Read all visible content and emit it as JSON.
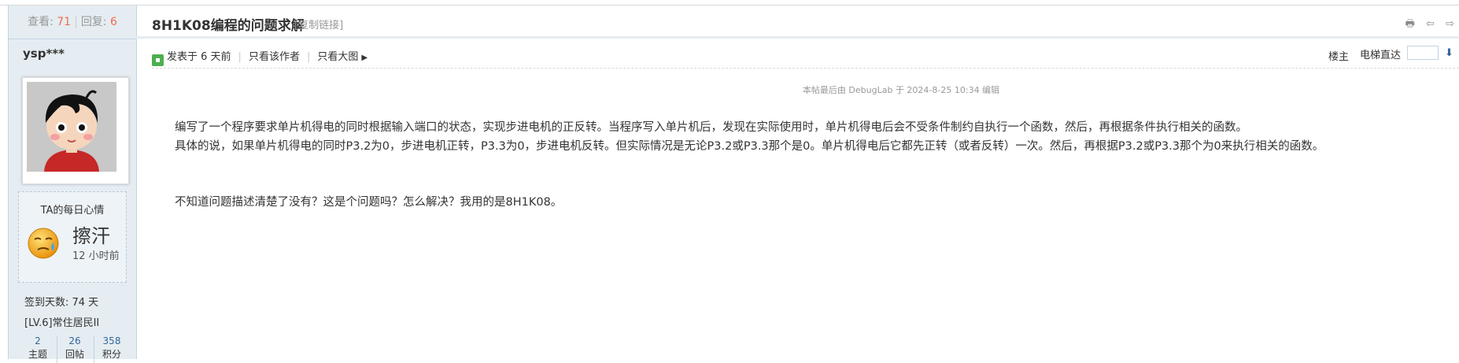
{
  "stats_bar": {
    "views_label": "查看:",
    "views": "71",
    "replies_label": "回复:",
    "replies": "6",
    "sep": "|"
  },
  "author": {
    "name": "ysp***"
  },
  "mood": {
    "title": "TA的每日心情",
    "text": "擦汗",
    "time": "12 小时前",
    "icon": "sweat-face-icon"
  },
  "signin": "签到天数: 74 天",
  "level": "[LV.6]常住居民II",
  "counters": [
    {
      "num": "2",
      "label": "主题"
    },
    {
      "num": "26",
      "label": "回帖"
    },
    {
      "num": "358",
      "label": "积分"
    }
  ],
  "thread": {
    "title": "8H1K08编程的问题求解",
    "copy_link": "[复制链接]"
  },
  "post_meta": {
    "posted": "发表于 6 天前",
    "only_author": "只看该作者",
    "only_big": "只看大图"
  },
  "floor": {
    "label": "楼主",
    "jump_label": "电梯直达",
    "jump_value": ""
  },
  "post": {
    "edited_note": "本帖最后由 DebugLab 于 2024-8-25 10:34 编辑",
    "line1": "编写了一个程序要求单片机得电的同时根据输入端口的状态，实现步进电机的正反转。当程序写入单片机后，发现在实际使用时，单片机得电后会不受条件制约自执行一个函数，然后，再根据条件执行相关的函数。",
    "line2": "具体的说，如果单片机得电的同时P3.2为0，步进电机正转，P3.3为0，步进电机反转。但实际情况是无论P3.2或P3.3那个是0。单片机得电后它都先正转（或者反转）一次。然后，再根据P3.2或P3.3那个为0来执行相关的函数。",
    "line3": "不知道问题描述清楚了没有？这是个问题吗？怎么解决？我用的是8H1K08。"
  },
  "colors": {
    "side_bg": "#e5edf2",
    "border": "#c2d5e3",
    "accent": "#f26c4f",
    "link": "#336699"
  }
}
